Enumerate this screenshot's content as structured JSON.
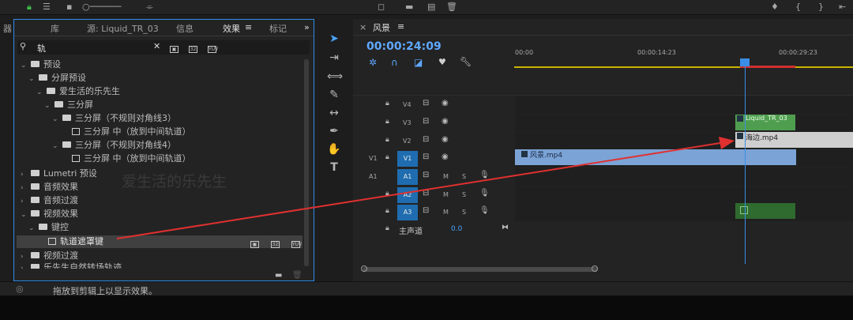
{
  "panel_tabs": [
    "器",
    "库",
    "源: Liquid_TR_03",
    "信息",
    "效果",
    "标记"
  ],
  "search": {
    "value": "轨"
  },
  "tree": [
    {
      "label": "预设"
    },
    {
      "label": "分屏预设"
    },
    {
      "label": "爱生活的乐先生"
    },
    {
      "label": "三分屏"
    },
    {
      "label": "三分屏（不规则对角线3）"
    },
    {
      "label": "三分屏 中（放到中间轨道）"
    },
    {
      "label": "三分屏（不规则对角线4）"
    },
    {
      "label": "三分屏 中（放到中间轨道）"
    },
    {
      "label": "Lumetri 预设"
    },
    {
      "label": "音频效果"
    },
    {
      "label": "音频过渡"
    },
    {
      "label": "视频效果"
    },
    {
      "label": "键控"
    },
    {
      "label": "轨道遮罩键"
    },
    {
      "label": "视频过渡"
    },
    {
      "label": "乐先生自然转场轨迹"
    }
  ],
  "watermark": "爱生活的乐先生",
  "status": {
    "text": "拖放到剪辑上以显示效果。"
  },
  "timeline": {
    "sequence_name": "风景",
    "timecode": "00:00:24:09",
    "ruler": [
      "00:00",
      "00:00:14:23",
      "00:00:29:23"
    ],
    "tracks": {
      "v4": "V4",
      "v3": "V3",
      "v2": "V2",
      "v1": "V1",
      "a1": "A1",
      "a2": "A2",
      "a3": "A3",
      "v1_src": "V1",
      "a1_src": "A1",
      "m": "M",
      "s": "S",
      "master": "主声道",
      "master_value": "0.0"
    },
    "clips": {
      "liquid": "Liquid_TR_03",
      "sea": "海边.mp4",
      "scene": "风景.mp4"
    }
  },
  "colors": {
    "accent": "#2d8ceb",
    "clip_green": "#4f9e4f",
    "clip_blue": "#7ba3d6",
    "arrow": "#e03030",
    "playhead": "#3a8ee6"
  }
}
